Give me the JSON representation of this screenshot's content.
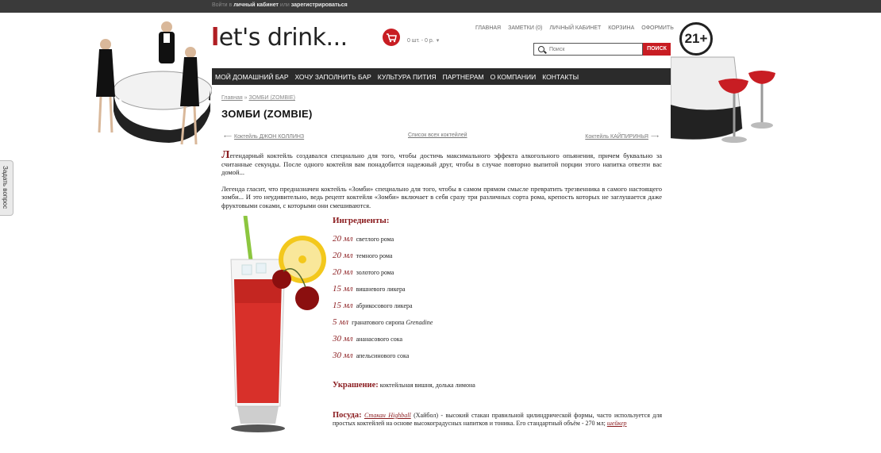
{
  "topbar": {
    "login_prefix": "Войти в",
    "login_link": "личный кабинет",
    "or_text": "или",
    "register_link": "зарегистрироваться"
  },
  "side_tab": "Задать вопрос",
  "header": {
    "logo_accent": "l",
    "logo_rest": "et's drink...",
    "cart_text": "0 шт. - 0 р.",
    "age_badge": "21+"
  },
  "topnav": [
    "ГЛАВНАЯ",
    "ЗАМЕТКИ (0)",
    "ЛИЧНЫЙ КАБИНЕТ",
    "КОРЗИНА",
    "ОФОРМИТЬ"
  ],
  "search": {
    "placeholder": "Поиск",
    "button": "ПОИСК"
  },
  "mainnav": [
    "МОЙ ДОМАШНИЙ БАР",
    "ХОЧУ ЗАПОЛНИТЬ БАР",
    "КУЛЬТУРА ПИТИЯ",
    "ПАРТНЕРАМ",
    "О КОМПАНИИ",
    "КОНТАКТЫ"
  ],
  "breadcrumb": {
    "home": "Главная",
    "sep": "»",
    "current": "ЗОМБИ (ZOMBIE)"
  },
  "page_title": "ЗОМБИ (ZOMBIE)",
  "pager": {
    "prev": "Коктейль ДЖОН КОЛЛИНЗ",
    "list": "Список всех коктейлей",
    "next": "Коктейль КАЙПИРИНЬЯ"
  },
  "intro": {
    "drop_cap": "Л",
    "p1_rest": "егендарный коктейль создавался специально для того, чтобы достичь максимального эффекта алкогольного опьянения, причем буквально за считанные секунды. После одного коктейля вам понадобится надежный друг, чтобы в случае повторно выпитой порции этого напитка отвезти вас домой...",
    "p2": "Легенда гласит, что предназначен коктейль «Зомби» специально для того, чтобы в самом прямом смысле превратить трезвенника в самого настоящего зомби... И это неудивительно, ведь рецепт коктейля «Зомби» включает в себя сразу три различных сорта рома, крепость которых не заглушается даже фруктовыми соками, с которыми они смешиваются."
  },
  "ingredients_heading": "Ингредиенты:",
  "ingredients": [
    {
      "amount": "20 мл",
      "name": "светлого рома",
      "extra": ""
    },
    {
      "amount": "20 мл",
      "name": "темного рома",
      "extra": ""
    },
    {
      "amount": "20 мл",
      "name": "золотого рома",
      "extra": ""
    },
    {
      "amount": "15 мл",
      "name": "вишневого ликера",
      "extra": ""
    },
    {
      "amount": "15 мл",
      "name": "абрикосового ликера",
      "extra": ""
    },
    {
      "amount": "5 мл",
      "name": "гранатового сиропа",
      "extra": "Grenadine"
    },
    {
      "amount": "30 мл",
      "name": "ананасового сока",
      "extra": ""
    },
    {
      "amount": "30 мл",
      "name": "апельсинового сока",
      "extra": ""
    }
  ],
  "garnish": {
    "label": "Украшение:",
    "text": "коктейльная вишня, долька лимона"
  },
  "serving": {
    "label": "Посуда:",
    "glass_link": "Стакан Highball",
    "text": "(Хайбол) - высокий стакан правильной цилиндрической формы, часто используется для простых коктейлей на основе высокоградусных напитков и тоника. Его стандартный объём - 270 мл;",
    "tool_link": "шейкер"
  },
  "colors": {
    "accent": "#c81d23",
    "brand_dark": "#8a1b1e",
    "nav_bg": "#2b2b2b"
  }
}
